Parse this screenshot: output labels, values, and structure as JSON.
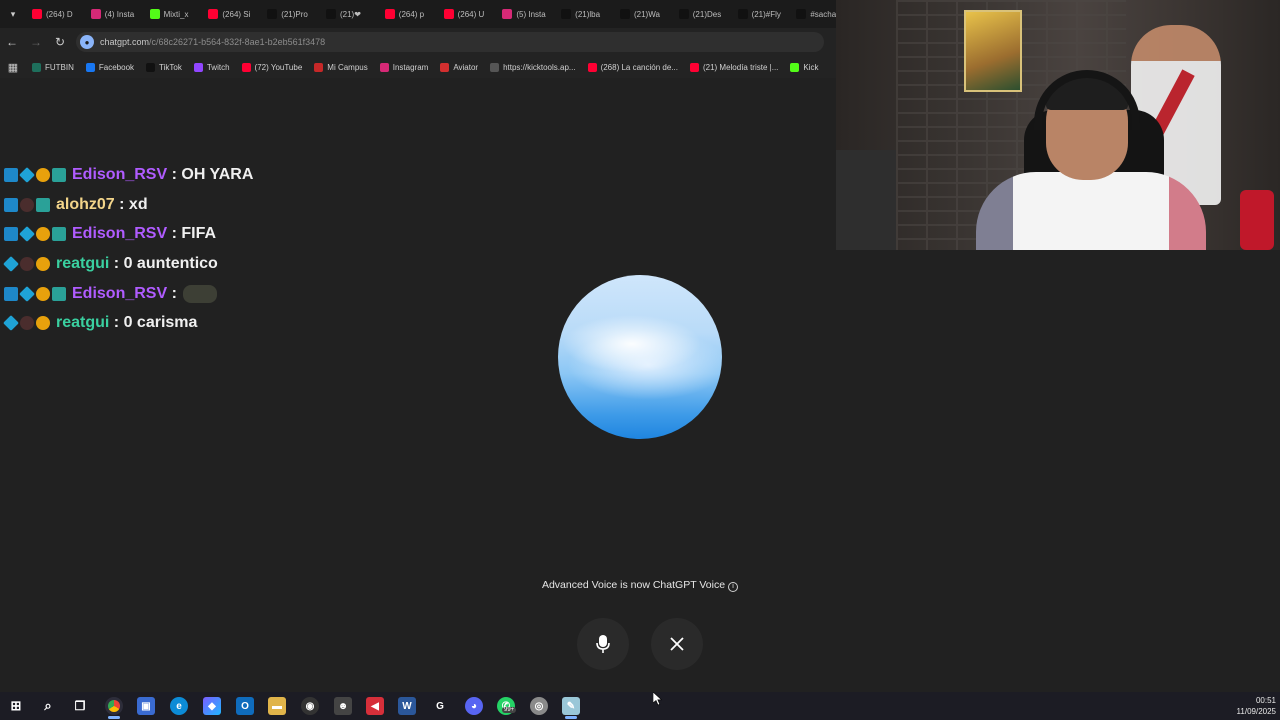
{
  "tabs": [
    {
      "label": "(264) D",
      "icon": "youtube-icon",
      "color": "#ff0033"
    },
    {
      "label": "(4) Insta",
      "icon": "instagram-icon",
      "color": "#d62976"
    },
    {
      "label": "Mixti_x",
      "icon": "kick-icon",
      "color": "#53fc18"
    },
    {
      "label": "(264) Si",
      "icon": "youtube-icon",
      "color": "#ff0033"
    },
    {
      "label": "(21)Pro",
      "icon": "tiktok-icon",
      "color": "#111111"
    },
    {
      "label": "(21)❤",
      "icon": "tiktok-icon",
      "color": "#111111"
    },
    {
      "label": "(264) p",
      "icon": "youtube-icon",
      "color": "#ff0033"
    },
    {
      "label": "(264) U",
      "icon": "youtube-icon",
      "color": "#ff0033"
    },
    {
      "label": "(5) Insta",
      "icon": "instagram-icon",
      "color": "#d62976"
    },
    {
      "label": "(21)lba",
      "icon": "tiktok-icon",
      "color": "#111111"
    },
    {
      "label": "(21)Wa",
      "icon": "tiktok-icon",
      "color": "#111111"
    },
    {
      "label": "(21)Des",
      "icon": "tiktok-icon",
      "color": "#111111"
    },
    {
      "label": "(21)#Fly",
      "icon": "tiktok-icon",
      "color": "#111111"
    },
    {
      "label": "#sacha",
      "icon": "tiktok-icon",
      "color": "#111111"
    }
  ],
  "toolbar": {
    "url_host": "chatgpt.com",
    "url_path": "/c/68c26271-b564-832f-8ae1-b2eb561f3478"
  },
  "bookmarks": [
    {
      "label": "FUTBIN",
      "icon": "futbin-icon",
      "color": "#1e6f5c"
    },
    {
      "label": "Facebook",
      "icon": "facebook-icon",
      "color": "#1877f2"
    },
    {
      "label": "TikTok",
      "icon": "tiktok-icon",
      "color": "#111111"
    },
    {
      "label": "Twitch",
      "icon": "twitch-icon",
      "color": "#9146ff"
    },
    {
      "label": "(72) YouTube",
      "icon": "youtube-icon",
      "color": "#ff0033"
    },
    {
      "label": "Mi Campus",
      "icon": "campus-icon",
      "color": "#c62828"
    },
    {
      "label": "Instagram",
      "icon": "instagram-icon",
      "color": "#d62976"
    },
    {
      "label": "Aviator",
      "icon": "aviator-icon",
      "color": "#d32f2f"
    },
    {
      "label": "https://kicktools.ap...",
      "icon": "grid-icon",
      "color": "#555555"
    },
    {
      "label": "(268) La canción de...",
      "icon": "youtube-icon",
      "color": "#ff0033"
    },
    {
      "label": "(21) Melodía triste |...",
      "icon": "youtube-icon",
      "color": "#ff0033"
    },
    {
      "label": "Kick",
      "icon": "kick-icon",
      "color": "#53fc18"
    }
  ],
  "chat": [
    {
      "user": "Edison_RSV",
      "color": "#b05cff",
      "message": ": OH YARA",
      "badges": [
        "arrow",
        "cube",
        "one",
        "mod"
      ],
      "emote": false
    },
    {
      "user": "alohz07",
      "color": "#f3d58a",
      "message": ": xd",
      "badges": [
        "arrow",
        "bear",
        "mod"
      ],
      "emote": false
    },
    {
      "user": "Edison_RSV",
      "color": "#b05cff",
      "message": ": FIFA",
      "badges": [
        "arrow",
        "cube",
        "one",
        "mod"
      ],
      "emote": false
    },
    {
      "user": "reatgui",
      "color": "#3ad0a0",
      "message": ": 0 auntentico",
      "badges": [
        "cube",
        "bear",
        "one"
      ],
      "emote": false
    },
    {
      "user": "Edison_RSV",
      "color": "#b05cff",
      "message": ":",
      "badges": [
        "arrow",
        "cube",
        "one",
        "mod"
      ],
      "emote": true
    },
    {
      "user": "reatgui",
      "color": "#3ad0a0",
      "message": ": 0 carisma",
      "badges": [
        "cube",
        "bear",
        "one"
      ],
      "emote": false
    }
  ],
  "voice": {
    "notice": "Advanced Voice is now ChatGPT Voice",
    "info_symbol": "i"
  },
  "taskbar": {
    "time": "00:51",
    "date": "11/09/2025",
    "whatsapp_badge": "99+"
  }
}
